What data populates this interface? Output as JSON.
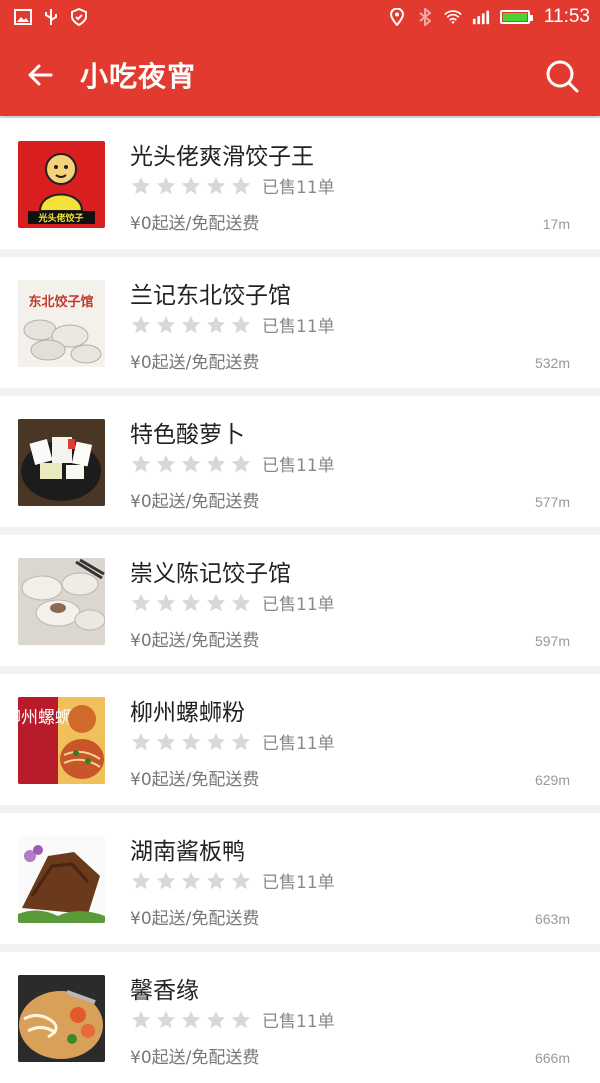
{
  "status_bar": {
    "time": "11:53"
  },
  "app_bar": {
    "title": "小吃夜宵"
  },
  "shops": [
    {
      "name": "光头佬爽滑饺子王",
      "sold": "已售11单",
      "delivery": "¥0起送/免配送费",
      "distance": "17m",
      "rating": 0
    },
    {
      "name": "兰记东北饺子馆",
      "sold": "已售11单",
      "delivery": "¥0起送/免配送费",
      "distance": "532m",
      "rating": 0
    },
    {
      "name": "特色酸萝卜",
      "sold": "已售11单",
      "delivery": "¥0起送/免配送费",
      "distance": "577m",
      "rating": 0
    },
    {
      "name": "崇义陈记饺子馆",
      "sold": "已售11单",
      "delivery": "¥0起送/免配送费",
      "distance": "597m",
      "rating": 0
    },
    {
      "name": "柳州螺蛳粉",
      "sold": "已售11单",
      "delivery": "¥0起送/免配送费",
      "distance": "629m",
      "rating": 0
    },
    {
      "name": "湖南酱板鸭",
      "sold": "已售11单",
      "delivery": "¥0起送/免配送费",
      "distance": "663m",
      "rating": 0
    },
    {
      "name": "馨香缘",
      "sold": "已售11单",
      "delivery": "¥0起送/免配送费",
      "distance": "666m",
      "rating": 0
    }
  ],
  "thumb_texts": {
    "shop1_logo": "光头佬饺子",
    "shop2_banner": "东北饺子馆",
    "shop5_banner": "柳州螺蛳"
  },
  "colors": {
    "primary": "#e23a2e",
    "star_empty": "#d8d8d8",
    "battery": "#4cd137"
  },
  "icons": [
    "image-icon",
    "usb-icon",
    "shield-icon",
    "location-icon",
    "bluetooth-icon",
    "wifi-icon",
    "signal-icon",
    "battery-icon",
    "back-arrow-icon",
    "search-icon",
    "star-icon"
  ]
}
